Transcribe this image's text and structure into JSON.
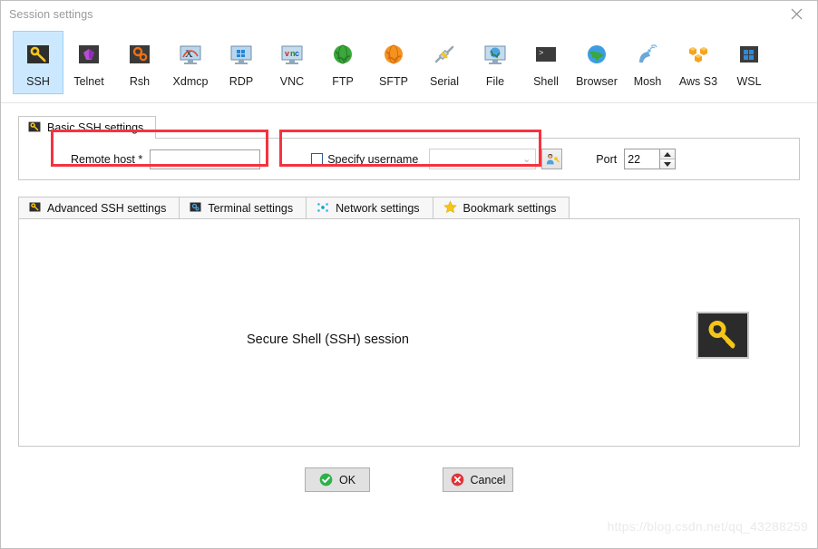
{
  "window": {
    "title": "Session settings",
    "close_label": "×",
    "close_icon": "close-icon"
  },
  "session_types": [
    {
      "label": "SSH",
      "icon": "ssh-key-icon",
      "selected": true
    },
    {
      "label": "Telnet",
      "icon": "telnet-icon",
      "selected": false
    },
    {
      "label": "Rsh",
      "icon": "rsh-gears-icon",
      "selected": false
    },
    {
      "label": "Xdmcp",
      "icon": "xdmcp-icon",
      "selected": false
    },
    {
      "label": "RDP",
      "icon": "rdp-windows-icon",
      "selected": false
    },
    {
      "label": "VNC",
      "icon": "vnc-icon",
      "selected": false
    },
    {
      "label": "FTP",
      "icon": "ftp-globe-icon",
      "selected": false
    },
    {
      "label": "SFTP",
      "icon": "sftp-globe-icon",
      "selected": false
    },
    {
      "label": "Serial",
      "icon": "serial-plug-icon",
      "selected": false
    },
    {
      "label": "File",
      "icon": "file-share-icon",
      "selected": false
    },
    {
      "label": "Shell",
      "icon": "shell-prompt-icon",
      "selected": false
    },
    {
      "label": "Browser",
      "icon": "browser-globe-icon",
      "selected": false
    },
    {
      "label": "Mosh",
      "icon": "mosh-dish-icon",
      "selected": false
    },
    {
      "label": "Aws S3",
      "icon": "aws-s3-icon",
      "selected": false
    },
    {
      "label": "WSL",
      "icon": "wsl-windows-icon",
      "selected": false
    }
  ],
  "basic": {
    "tab_label": "Basic SSH settings",
    "tab_icon": "ssh-key-icon",
    "remote_host_label": "Remote host *",
    "remote_host_value": "",
    "remote_host_placeholder": "",
    "specify_username_label": "Specify username",
    "specify_username_checked": false,
    "username_value": "",
    "username_dropdown_icon": "chevron-down-icon",
    "user_picker_icon": "user-key-icon",
    "port_label": "Port",
    "port_value": "22",
    "spin_up_icon": "spinner-up-icon",
    "spin_down_icon": "spinner-down-icon"
  },
  "lower_tabs": [
    {
      "label": "Advanced SSH settings",
      "icon": "ssh-key-icon"
    },
    {
      "label": "Terminal settings",
      "icon": "terminal-gear-icon"
    },
    {
      "label": "Network settings",
      "icon": "network-dots-icon"
    },
    {
      "label": "Bookmark settings",
      "icon": "star-icon"
    }
  ],
  "content": {
    "session_description": "Secure Shell (SSH) session",
    "big_icon": "ssh-key-icon"
  },
  "footer": {
    "ok_label": "OK",
    "ok_icon": "check-circle-icon",
    "cancel_label": "Cancel",
    "cancel_icon": "x-circle-icon"
  },
  "watermark": {
    "text": "https://blog.csdn.net/qq_43288259"
  },
  "colors": {
    "selection_blue": "#cce8ff",
    "highlight_red": "#f5333f",
    "ok_green": "#2fb14a",
    "cancel_red": "#e0353a",
    "key_yellow": "#f5c518"
  }
}
